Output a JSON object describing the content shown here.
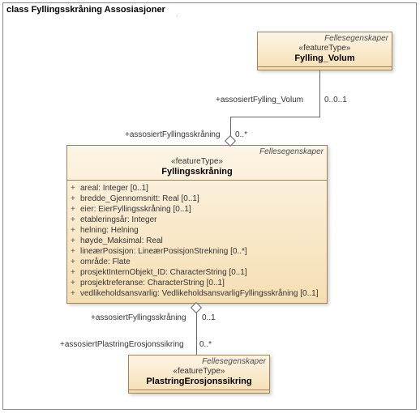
{
  "frame": {
    "title": "class Fyllingsskråning Assosiasjoner"
  },
  "classes": {
    "volum": {
      "tag": "Fellesegenskaper",
      "stereotype": "«featureType»",
      "name": "Fylling_Volum"
    },
    "skraning": {
      "tag": "Fellesegenskaper",
      "stereotype": "«featureType»",
      "name": "Fyllingsskråning",
      "attrs": [
        "areal: Integer [0..1]",
        "bredde_Gjennomsnitt: Real [0..1]",
        "eier: EierFyllingsskråning [0..1]",
        "etableringsår: Integer",
        "helning: Helning",
        "høyde_Maksimal: Real",
        "lineærPosisjon: LineærPosisjonStrekning [0..*]",
        "område: Flate",
        "prosjektInternObjekt_ID: CharacterString [0..1]",
        "prosjektreferanse: CharacterString [0..1]",
        "vedlikeholdsansvarlig: VedlikeholdsansvarligFyllingsskråning [0..1]"
      ]
    },
    "plastring": {
      "tag": "Fellesegenskaper",
      "stereotype": "«featureType»",
      "name": "PlastringErosjonssikring"
    }
  },
  "assocs": {
    "a1": {
      "role1": "+assosiertFylling_Volum",
      "mult1": "0..0..1",
      "role2": "+assosiertFyllingsskråning",
      "mult2": "0..*"
    },
    "a2": {
      "role1": "+assosiertFyllingsskråning",
      "mult1": "0..1",
      "role2": "+assosiertPlastringErosjonssikring",
      "mult2": "0..*"
    }
  }
}
